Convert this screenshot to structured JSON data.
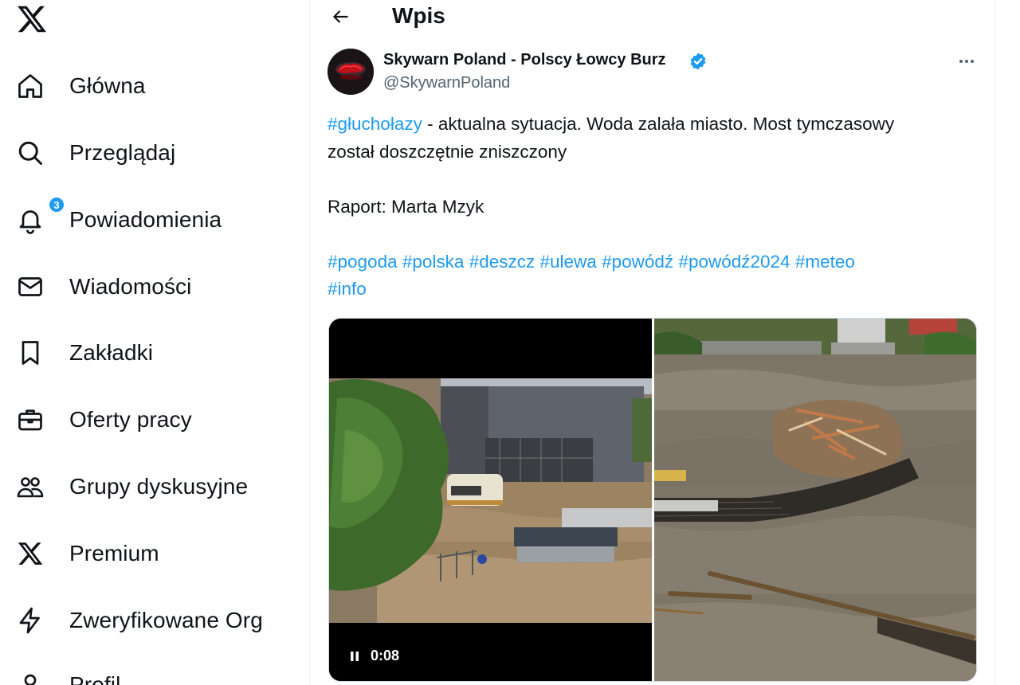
{
  "sidebar": {
    "logo": "x-logo-icon",
    "items": [
      {
        "label": "Główna",
        "icon": "home-icon"
      },
      {
        "label": "Przeglądaj",
        "icon": "search-icon"
      },
      {
        "label": "Powiadomienia",
        "icon": "bell-icon",
        "badge": "3"
      },
      {
        "label": "Wiadomości",
        "icon": "envelope-icon"
      },
      {
        "label": "Zakładki",
        "icon": "bookmark-icon"
      },
      {
        "label": "Oferty pracy",
        "icon": "briefcase-icon"
      },
      {
        "label": "Grupy dyskusyjne",
        "icon": "people-icon"
      },
      {
        "label": "Premium",
        "icon": "x-logo-icon"
      },
      {
        "label": "Zweryfikowane Org",
        "icon": "lightning-icon"
      },
      {
        "label": "Profil",
        "icon": "person-icon"
      }
    ]
  },
  "header": {
    "title": "Wpis",
    "back_icon": "arrow-left-icon"
  },
  "post": {
    "author": {
      "name": "Skywarn Poland - Polscy Łowcy Burz",
      "handle": "@SkywarnPoland",
      "verified": true
    },
    "more_icon": "more-horizontal-icon",
    "text": {
      "line1_tag": "#głuchołazy",
      "line1_rest": " - aktualna sytuacja. Woda zalała miasto. Most tymczasowy",
      "line2": "został doszczętnie zniszczony",
      "report": "Raport: Marta Mzyk",
      "hashtags": [
        "#pogoda",
        "#polska",
        "#deszcz",
        "#ulewa",
        "#powódź",
        "#powódź2024",
        "#meteo",
        "#info"
      ]
    },
    "media": {
      "video_time": "0:08",
      "pause_icon": "pause-icon"
    }
  },
  "colors": {
    "accent": "#1d9bf0",
    "text": "#0f1419",
    "secondary": "#536471"
  }
}
